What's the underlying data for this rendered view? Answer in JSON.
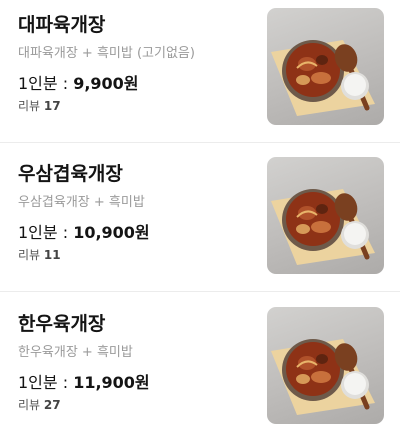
{
  "menu": {
    "items": [
      {
        "name": "대파육개장",
        "description": "대파육개장 + 흑미밥 (고기없음)",
        "price_label": "1인분 : ",
        "price": "9,900원",
        "review_label": "리뷰 ",
        "review_count": "17",
        "image_icon": "yukgaejang-bowl-photo"
      },
      {
        "name": "우삼겹육개장",
        "description": "우삼겹육개장 + 흑미밥",
        "price_label": "1인분 : ",
        "price": "10,900원",
        "review_label": "리뷰 ",
        "review_count": "11",
        "image_icon": "yukgaejang-bowl-photo"
      },
      {
        "name": "한우육개장",
        "description": "한우육개장 + 흑미밥",
        "price_label": "1인분 : ",
        "price": "11,900원",
        "review_label": "리뷰 ",
        "review_count": "27",
        "image_icon": "yukgaejang-bowl-photo"
      }
    ]
  },
  "colors": {
    "title": "#141414",
    "description": "#9a9a9a",
    "divider": "#ececec",
    "thumb_background": "#c4c2c0",
    "placemat": "#ecd39f",
    "soup": "#8e3216",
    "rice_bowl": "#f4f4f2"
  }
}
